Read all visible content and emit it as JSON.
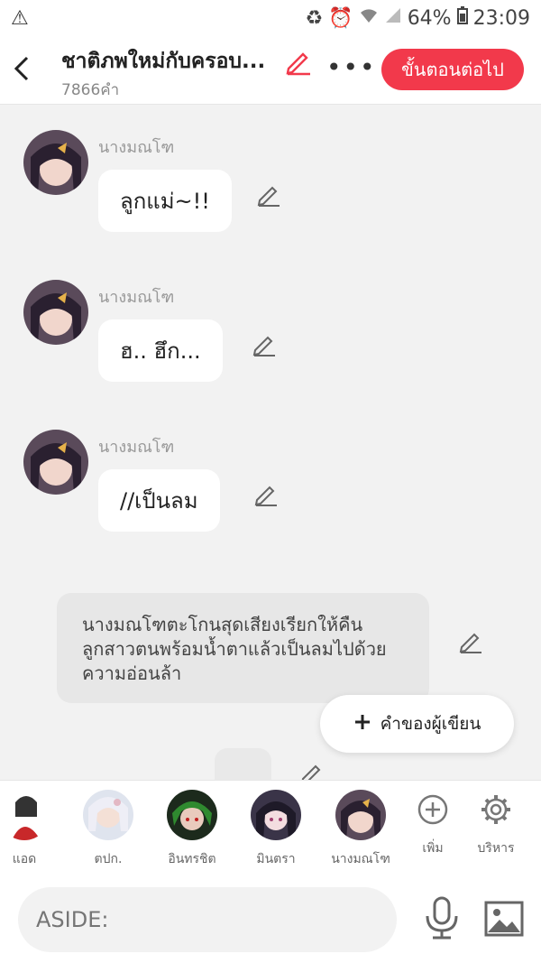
{
  "status_bar": {
    "battery": "64%",
    "time": "23:09"
  },
  "header": {
    "title": "ชาติภพใหม่กับครอบ...",
    "word_count": "7866คำ",
    "next_label": "ขั้นตอนต่อไป"
  },
  "messages": [
    {
      "speaker": "นางมณโฑ",
      "text": "ลูกแม่~!!"
    },
    {
      "speaker": "นางมณโฑ",
      "text": "ฮ.. ฮึก..."
    },
    {
      "speaker": "นางมณโฑ",
      "text": "//เป็นลม"
    }
  ],
  "narration": {
    "text": "นางมณโฑตะโกนสุดเสียงเรียกให้คืนลูกสาวตนพร้อมน้ำตาแล้วเป็นลมไปด้วยความอ่อนล้า"
  },
  "author_button": {
    "label": "คำของผู้เขียน"
  },
  "characters": [
    "แอด",
    "ตปก.",
    "อินทรชิต",
    "มินตรา",
    "นางมณโฑ"
  ],
  "tools": {
    "add": "เพิ่ม",
    "manage": "บริหาร"
  },
  "input": {
    "placeholder": "ASIDE:"
  },
  "colors": {
    "accent": "#f2394b"
  }
}
